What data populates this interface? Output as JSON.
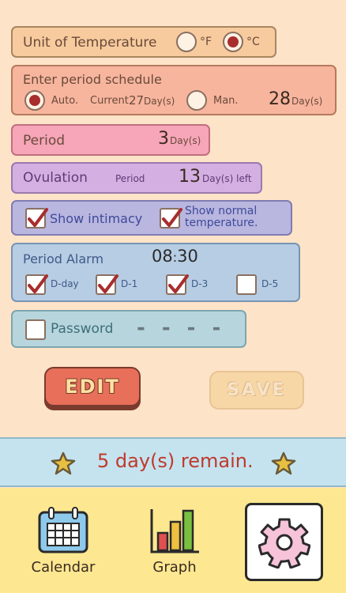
{
  "unit": {
    "label": "Unit of Temperature",
    "f_label": "°F",
    "c_label": "°C",
    "selected": "C"
  },
  "schedule": {
    "title": "Enter period schedule",
    "auto_label": "Auto.",
    "current_label": "Current",
    "current_value": "27",
    "current_unit": "Day(s)",
    "manual_label": "Man.",
    "manual_value": "28",
    "manual_unit": "Day(s)",
    "selected": "auto"
  },
  "period": {
    "label": "Period",
    "value": "3",
    "unit": "Day(s)"
  },
  "ovulation": {
    "label": "Ovulation",
    "sub_label": "Period",
    "value": "13",
    "unit": "Day(s) left"
  },
  "show": {
    "intimacy_label": "Show intimacy",
    "intimacy_checked": true,
    "temp_label_1": "Show normal",
    "temp_label_2": "temperature.",
    "temp_checked": true
  },
  "alarm": {
    "title": "Period Alarm",
    "time_hour": "08",
    "time_sep": ":",
    "time_min": "30",
    "options": [
      {
        "label": "D-day",
        "checked": true
      },
      {
        "label": "D-1",
        "checked": true
      },
      {
        "label": "D-3",
        "checked": true
      },
      {
        "label": "D-5",
        "checked": false
      }
    ]
  },
  "password": {
    "label": "Password",
    "checked": false,
    "placeholder_dashes": "- - - -"
  },
  "buttons": {
    "edit": "EDIT",
    "save": "SAVE"
  },
  "banner": {
    "text": "5 day(s) remain."
  },
  "nav": {
    "calendar": "Calendar",
    "graph": "Graph"
  },
  "colors": {
    "accent_red": "#a82d2d",
    "banner_text": "#c0392b",
    "footer": "#fde891",
    "background": "#fde3c8"
  }
}
